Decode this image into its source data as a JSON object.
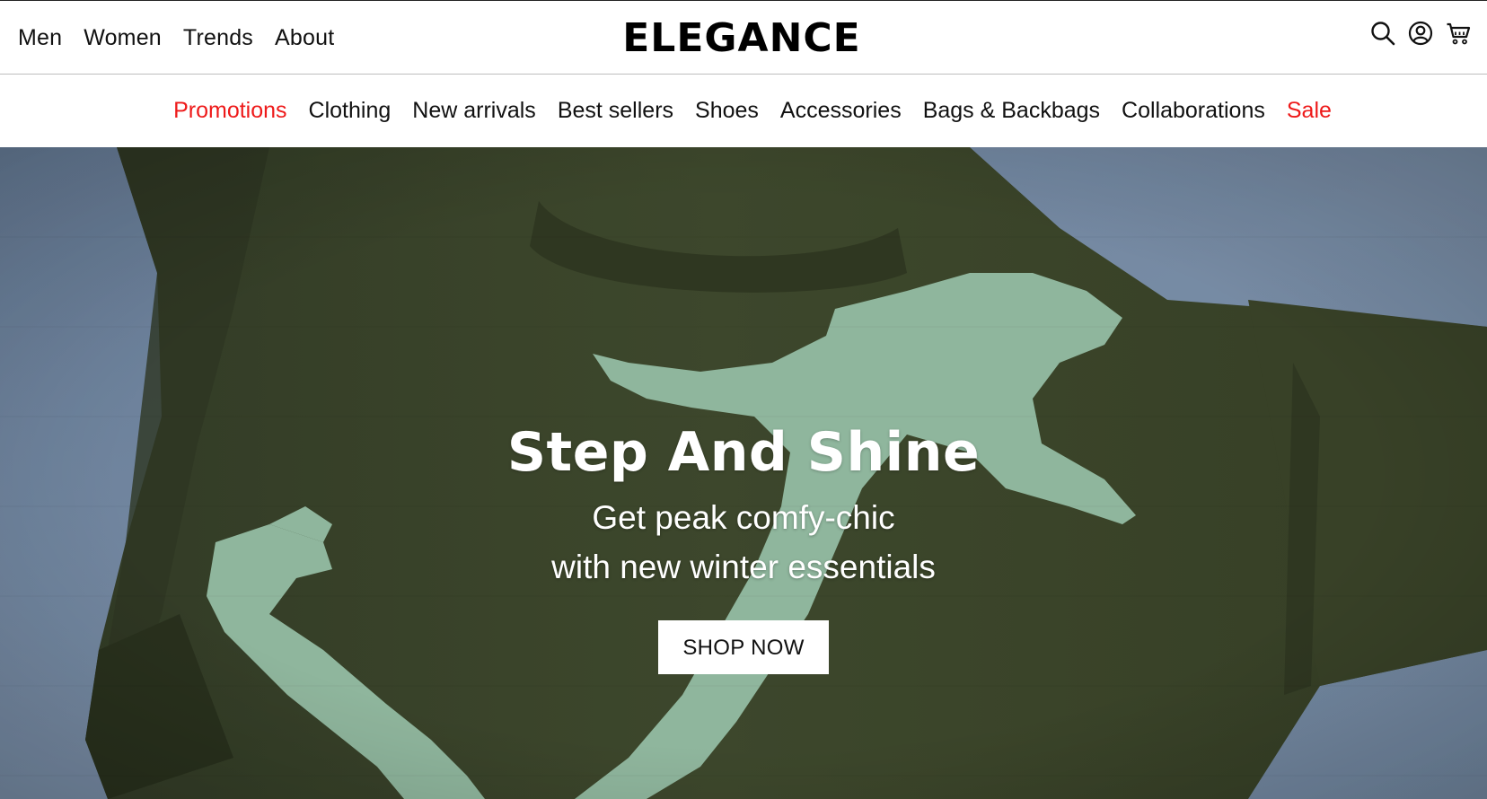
{
  "header": {
    "top_nav": [
      {
        "label": "Men"
      },
      {
        "label": "Women"
      },
      {
        "label": "Trends"
      },
      {
        "label": "About"
      }
    ],
    "logo": "ELEGANCE",
    "icons": [
      "search-icon",
      "account-icon",
      "cart-icon"
    ]
  },
  "category_nav": {
    "items": [
      {
        "label": "Promotions",
        "highlight": true
      },
      {
        "label": "Clothing",
        "highlight": false
      },
      {
        "label": "New arrivals",
        "highlight": false
      },
      {
        "label": "Best sellers",
        "highlight": false
      },
      {
        "label": "Shoes",
        "highlight": false
      },
      {
        "label": "Accessories",
        "highlight": false
      },
      {
        "label": "Bags & Backbags",
        "highlight": false
      },
      {
        "label": "Collaborations",
        "highlight": false
      },
      {
        "label": "Sale",
        "highlight": true
      }
    ],
    "highlight_color": "#ee1a1a"
  },
  "hero": {
    "title": "Step And Shine",
    "subtitle_line1": "Get peak comfy-chic",
    "subtitle_line2": "with new winter essentials",
    "cta_label": "SHOP NOW",
    "colors": {
      "sky": "#7e93ad",
      "sweater": "#3f4a2c",
      "pattern": "#9fc7ad"
    }
  }
}
